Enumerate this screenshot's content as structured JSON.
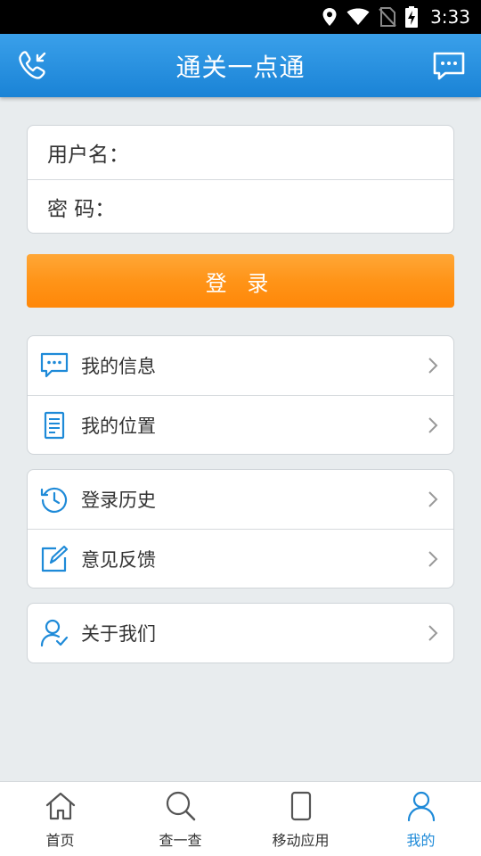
{
  "status_bar": {
    "time": "3:33"
  },
  "app_bar": {
    "title": "通关一点通"
  },
  "login": {
    "username_label": "用户名：",
    "password_label": "密 码：",
    "username_value": "",
    "password_value": "",
    "login_button": "登 录"
  },
  "menu_groups": [
    {
      "items": [
        {
          "label": "我的信息",
          "icon": "chat-icon"
        },
        {
          "label": "我的位置",
          "icon": "document-icon"
        }
      ]
    },
    {
      "items": [
        {
          "label": "登录历史",
          "icon": "history-icon"
        },
        {
          "label": "意见反馈",
          "icon": "edit-icon"
        }
      ]
    },
    {
      "items": [
        {
          "label": "关于我们",
          "icon": "user-check-icon"
        }
      ]
    }
  ],
  "bottom_nav": [
    {
      "label": "首页",
      "icon": "home-icon"
    },
    {
      "label": "查一查",
      "icon": "search-icon"
    },
    {
      "label": "移动应用",
      "icon": "phone-icon"
    },
    {
      "label": "我的",
      "icon": "user-icon",
      "active": true
    }
  ],
  "colors": {
    "primary": "#1e8ad8",
    "accent": "#ff9418",
    "background": "#e8ecee"
  }
}
